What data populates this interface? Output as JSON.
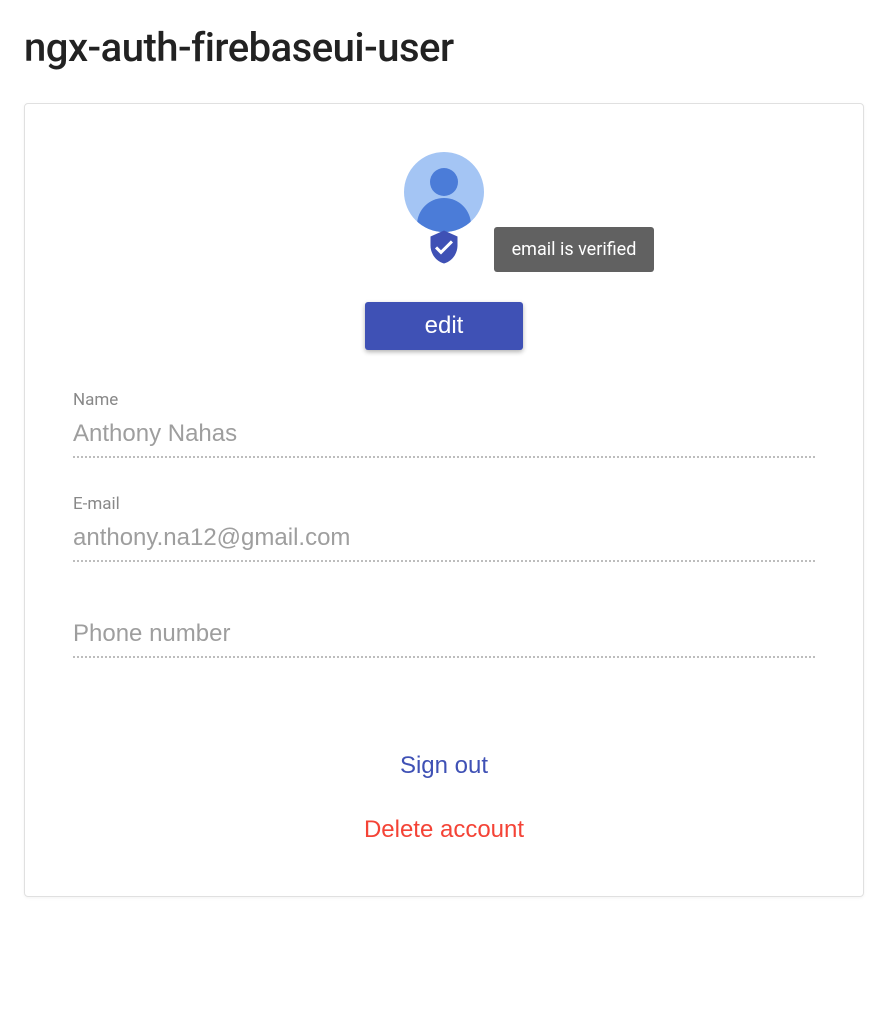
{
  "page_title": "ngx-auth-firebaseui-user",
  "verification": {
    "tooltip": "email is verified"
  },
  "buttons": {
    "edit": "edit",
    "sign_out": "Sign out",
    "delete_account": "Delete account"
  },
  "fields": {
    "name": {
      "label": "Name",
      "value": "Anthony Nahas"
    },
    "email": {
      "label": "E-mail",
      "value": "anthony.na12@gmail.com"
    },
    "phone": {
      "label": "",
      "placeholder": "Phone number",
      "value": ""
    }
  },
  "colors": {
    "primary": "#3f51b5",
    "danger": "#f44336",
    "avatar_bg": "#a4c5f4",
    "avatar_fg": "#4b7cd8"
  }
}
